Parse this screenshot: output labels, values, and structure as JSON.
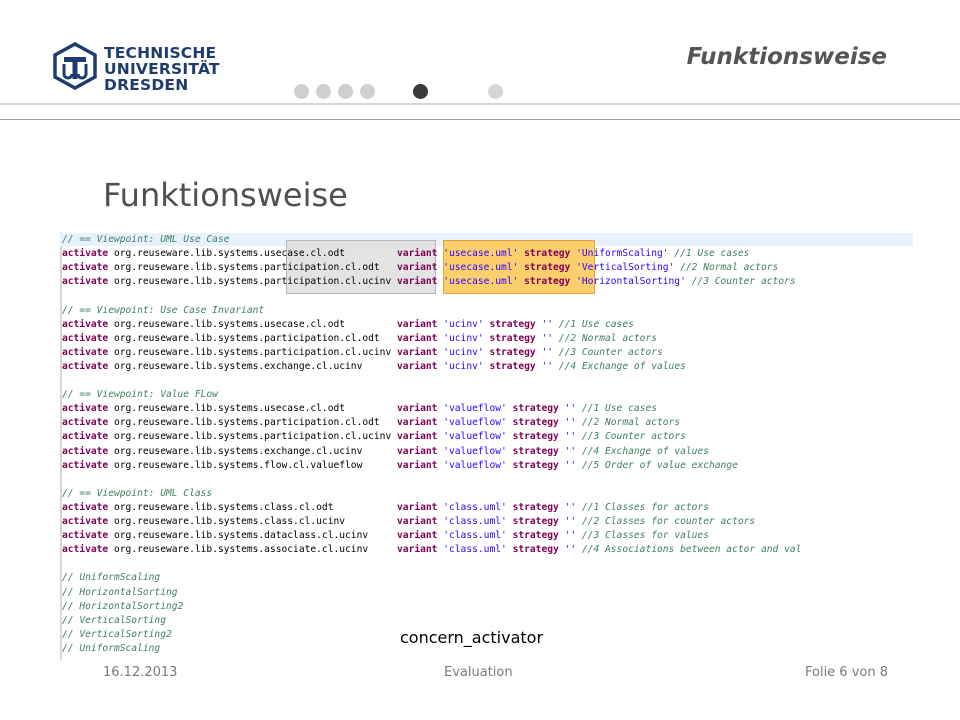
{
  "header": {
    "logo_lines": [
      "TECHNISCHE",
      "UNIVERSITÄT",
      "DRESDEN"
    ],
    "title": "Funktionsweise"
  },
  "slide": {
    "title": "Funktionsweise",
    "caption": "concern_activator"
  },
  "code_lines": [
    {
      "text": "// == Viewpoint: UML Use Case"
    },
    {
      "text": "activate org.reuseware.lib.systems.usecase.cl.odt         variant 'usecase.uml' strategy 'UniformScaling' //1 Use cases"
    },
    {
      "text": "activate org.reuseware.lib.systems.participation.cl.odt   variant 'usecase.uml' strategy 'VerticalSorting' //2 Normal actors"
    },
    {
      "text": "activate org.reuseware.lib.systems.participation.cl.ucinv variant 'usecase.uml' strategy 'HorizontalSorting' //3 Counter actors"
    },
    {
      "text": ""
    },
    {
      "text": "// == Viewpoint: Use Case Invariant"
    },
    {
      "text": "activate org.reuseware.lib.systems.usecase.cl.odt         variant 'ucinv' strategy '' //1 Use cases"
    },
    {
      "text": "activate org.reuseware.lib.systems.participation.cl.odt   variant 'ucinv' strategy '' //2 Normal actors"
    },
    {
      "text": "activate org.reuseware.lib.systems.participation.cl.ucinv variant 'ucinv' strategy '' //3 Counter actors"
    },
    {
      "text": "activate org.reuseware.lib.systems.exchange.cl.ucinv      variant 'ucinv' strategy '' //4 Exchange of values"
    },
    {
      "text": ""
    },
    {
      "text": "// == Viewpoint: Value FLow"
    },
    {
      "text": "activate org.reuseware.lib.systems.usecase.cl.odt         variant 'valueflow' strategy '' //1 Use cases"
    },
    {
      "text": "activate org.reuseware.lib.systems.participation.cl.odt   variant 'valueflow' strategy '' //2 Normal actors"
    },
    {
      "text": "activate org.reuseware.lib.systems.participation.cl.ucinv variant 'valueflow' strategy '' //3 Counter actors"
    },
    {
      "text": "activate org.reuseware.lib.systems.exchange.cl.ucinv      variant 'valueflow' strategy '' //4 Exchange of values"
    },
    {
      "text": "activate org.reuseware.lib.systems.flow.cl.valueflow      variant 'valueflow' strategy '' //5 Order of value exchange"
    },
    {
      "text": ""
    },
    {
      "text": "// == Viewpoint: UML Class"
    },
    {
      "text": "activate org.reuseware.lib.systems.class.cl.odt           variant 'class.uml' strategy '' //1 Classes for actors"
    },
    {
      "text": "activate org.reuseware.lib.systems.class.cl.ucinv         variant 'class.uml' strategy '' //2 Classes for counter actors"
    },
    {
      "text": "activate org.reuseware.lib.systems.dataclass.cl.ucinv     variant 'class.uml' strategy '' //3 Classes for values"
    },
    {
      "text": "activate org.reuseware.lib.systems.associate.cl.ucinv     variant 'class.uml' strategy '' //4 Associations between actor and val"
    },
    {
      "text": ""
    },
    {
      "text": "// UniformScaling"
    },
    {
      "text": "// HorizontalSorting"
    },
    {
      "text": "// HorizontalSorting2"
    },
    {
      "text": "// VerticalSorting"
    },
    {
      "text": "// VerticalSorting2"
    },
    {
      "text": "// UniformScaling"
    }
  ],
  "footer": {
    "date": "16.12.2013",
    "section": "Evaluation",
    "page": "Folie 6 von 8"
  },
  "colors": {
    "keyword": "#7f0055",
    "comment": "#3f7f5f",
    "string": "#2a00ff",
    "highlight_orange": "#fccf6c",
    "highlight_gray": "#e3e3e3",
    "logo_blue": "#1e3c6e"
  },
  "icons": {
    "logo": "tu-dresden-logo-icon",
    "progress": "slide-progress-dots"
  }
}
